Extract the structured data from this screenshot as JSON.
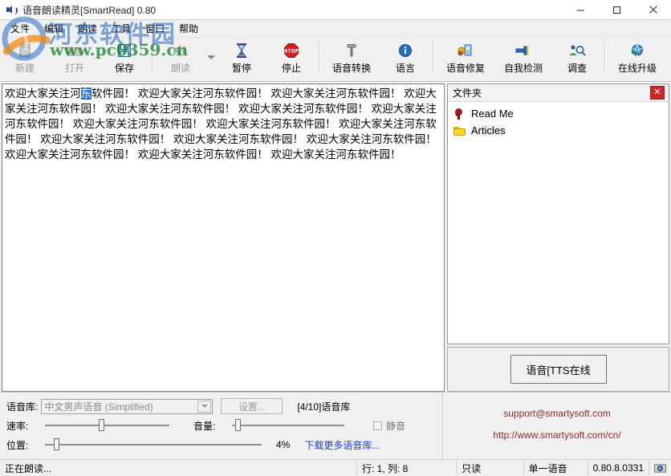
{
  "window": {
    "title": "语音朗读精灵[SmartRead] 0.80",
    "icon": "speaker-icon",
    "minimize": "—",
    "maximize": "▫",
    "close": "✕"
  },
  "menubar": {
    "items": [
      {
        "label": "文件",
        "name": "menu-file"
      },
      {
        "label": "编辑",
        "name": "menu-edit"
      },
      {
        "label": "朗读",
        "name": "menu-read"
      },
      {
        "label": "工具",
        "name": "menu-tools"
      },
      {
        "label": "窗口",
        "name": "menu-window"
      },
      {
        "label": "帮助",
        "name": "menu-help"
      }
    ]
  },
  "toolbar": {
    "buttons": [
      {
        "label": "新建",
        "icon": "new-file-icon",
        "disabled": true
      },
      {
        "label": "打开",
        "icon": "open-folder-icon",
        "disabled": true
      },
      {
        "label": "保存",
        "icon": "save-disk-icon",
        "disabled": false
      },
      {
        "label": "朗读",
        "icon": "speaker-icon",
        "disabled": true
      },
      {
        "label": "暂停",
        "icon": "hourglass-icon",
        "disabled": false
      },
      {
        "label": "停止",
        "icon": "stop-sign-icon",
        "disabled": false
      },
      {
        "label": "语音转换",
        "icon": "hammer-icon",
        "disabled": false
      },
      {
        "label": "语言",
        "icon": "info-icon",
        "disabled": false
      },
      {
        "label": "语音修复",
        "icon": "repair-icon",
        "disabled": false
      },
      {
        "label": "自我检测",
        "icon": "plug-icon",
        "disabled": false
      },
      {
        "label": "调查",
        "icon": "survey-icon",
        "disabled": false
      },
      {
        "label": "在线升级",
        "icon": "globe-icon",
        "disabled": false
      }
    ]
  },
  "editor": {
    "text_before": "欢迎大家关注河",
    "text_selected": "东",
    "text_after": "软件园！ 欢迎大家关注河东软件园！ 欢迎大家关注河东软件园！ 欢迎大家关注河东软件园！ 欢迎大家关注河东软件园！ 欢迎大家关注河东软件园！ 欢迎大家关注河东软件园！ 欢迎大家关注河东软件园！ 欢迎大家关注河东软件园！ 欢迎大家关注河东软件园！ 欢迎大家关注河东软件园！ 欢迎大家关注河东软件园！ 欢迎大家关注河东软件园！ 欢迎大家关注河东软件园！ 欢迎大家关注河东软件园！ 欢迎大家关注河东软件园！"
  },
  "folder_panel": {
    "title": "文件夹",
    "close_label": "✕",
    "items": [
      {
        "label": "Read Me",
        "icon": "readme-icon"
      },
      {
        "label": "Articles",
        "icon": "folder-icon"
      }
    ]
  },
  "tts_panel": {
    "button_label": "语音[TTS在线"
  },
  "controls": {
    "voice_label": "语音库:",
    "voice_value": "中文男声语音 (Simplified)",
    "settings_label": "设置...",
    "voice_count": "[4/10]语音库",
    "rate_label": "速率:",
    "rate_percent": 45,
    "volume_label": "音量:",
    "volume_percent": 3,
    "mute_label": "静音",
    "position_label": "位置:",
    "position_percent": 4,
    "position_value": "4%",
    "download_link": "下载更多语音库..."
  },
  "support": {
    "email": "support@smartysoft.com",
    "url": "http://www.smartysoft.com/cn/"
  },
  "statusbar": {
    "message": "正在朗读...",
    "position": "行: 1, 列: 8",
    "readonly": "只读",
    "mode": "单一语音",
    "version": "0.80.8.0331",
    "tray_icon": "camera-icon"
  },
  "watermark": {
    "site_cn": "河东软件园",
    "site_url": "www.pc0359.cn"
  },
  "colors": {
    "selection": "#2a72d4",
    "link": "#1b44c8",
    "support_text": "#8d2b2b",
    "close_button": "#cc2727",
    "window_bg": "#f0f0f0"
  }
}
